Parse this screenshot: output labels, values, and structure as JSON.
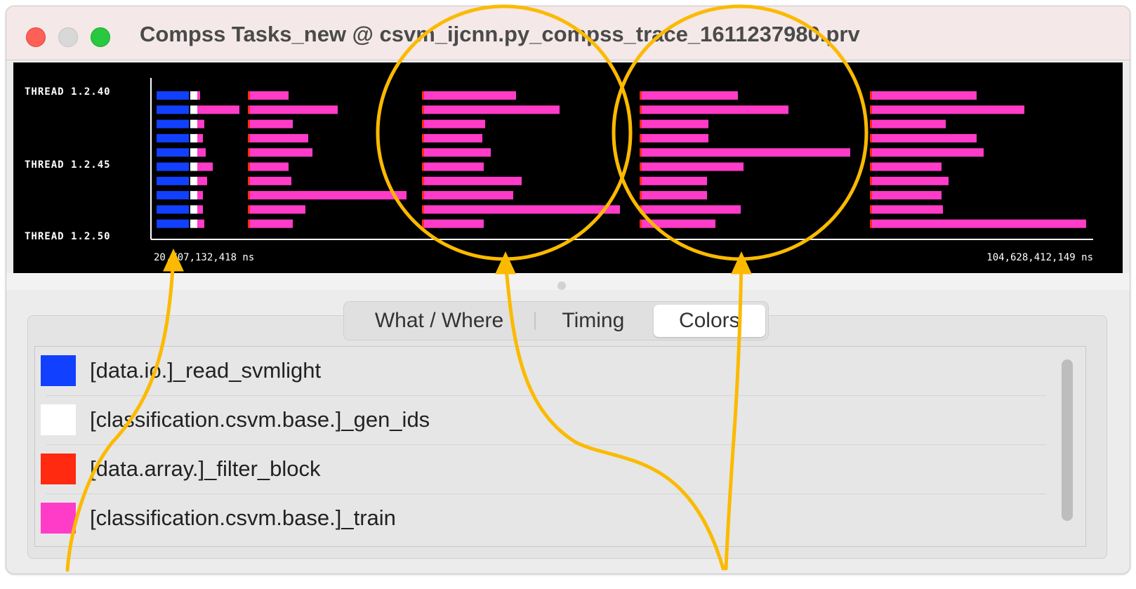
{
  "window": {
    "title": "Compss Tasks_new @ csvm_ijcnn.py_compss_trace_1611237980.prv"
  },
  "trace": {
    "thread_labels": [
      "THREAD 1.2.40",
      "THREAD 1.2.45",
      "THREAD 1.2.50"
    ],
    "time_start": "20,707,132,418 ns",
    "time_end": "104,628,412,149 ns"
  },
  "tabs": {
    "what_where": "What / Where",
    "timing": "Timing",
    "colors": "Colors"
  },
  "legend": {
    "items": [
      {
        "label": "[data.io.]_read_svmlight",
        "color": "#1240ff"
      },
      {
        "label": "[classification.csvm.base.]_gen_ids",
        "color": "#ffffff"
      },
      {
        "label": "[data.array.]_filter_block",
        "color": "#ff2a10"
      },
      {
        "label": "[classification.csvm.base.]_train",
        "color": "#ff3cc8"
      }
    ]
  },
  "colors": {
    "annotation": "#fbba00"
  }
}
